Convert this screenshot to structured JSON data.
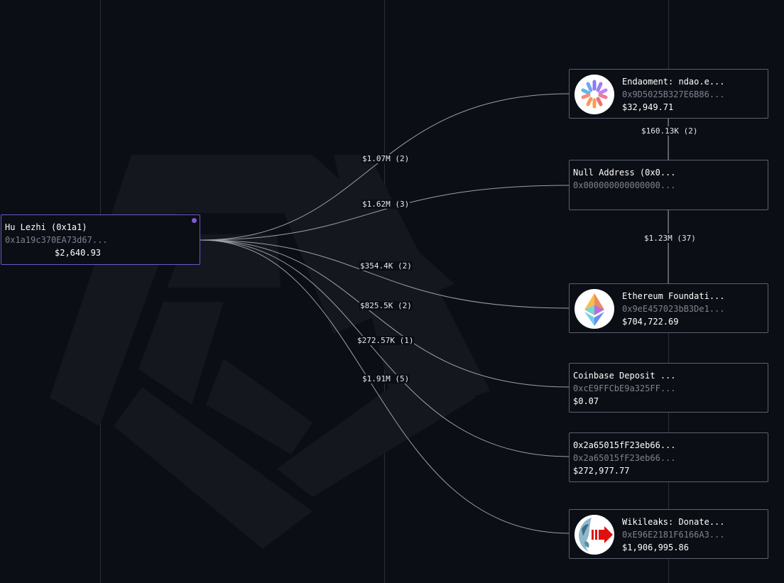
{
  "source": {
    "name": "Hu Lezhi (0x1a1)",
    "address": "0x1a19c370EA73d67...",
    "balance": "$2,640.93"
  },
  "targets": [
    {
      "name": "Endaoment: ndao.e...",
      "address": "0x9D5025B327E6B86...",
      "balance": "$32,949.71",
      "icon": "endaoment-logo-icon"
    },
    {
      "name": "Null Address (0x0...",
      "address": "0x000000000000000...",
      "balance": "",
      "icon": ""
    },
    {
      "name": "Ethereum Foundati...",
      "address": "0x9eE457023bB3De1...",
      "balance": "$704,722.69",
      "icon": "ethereum-logo-icon"
    },
    {
      "name": "Coinbase Deposit ...",
      "address": "0xcE9FFCbE9a325FF...",
      "balance": "$0.07",
      "icon": ""
    },
    {
      "name": "0x2a65015fF23eb66...",
      "address": "0x2a65015fF23eb66...",
      "balance": "$272,977.77",
      "icon": ""
    },
    {
      "name": "Wikileaks: Donate...",
      "address": "0xE96E2181F6166A3...",
      "balance": "$1,906,995.86",
      "icon": "wikileaks-logo-icon"
    }
  ],
  "edges": [
    {
      "label": "$1.07M (2)"
    },
    {
      "label": "$1.62M (3)"
    },
    {
      "label": "$354.4K (2)"
    },
    {
      "label": "$825.5K (2)"
    },
    {
      "label": "$272.57K (1)"
    },
    {
      "label": "$1.91M (5)"
    }
  ],
  "vertical_edges": [
    {
      "label": "$160.13K (2)"
    },
    {
      "label": "$1.23M (37)"
    }
  ]
}
